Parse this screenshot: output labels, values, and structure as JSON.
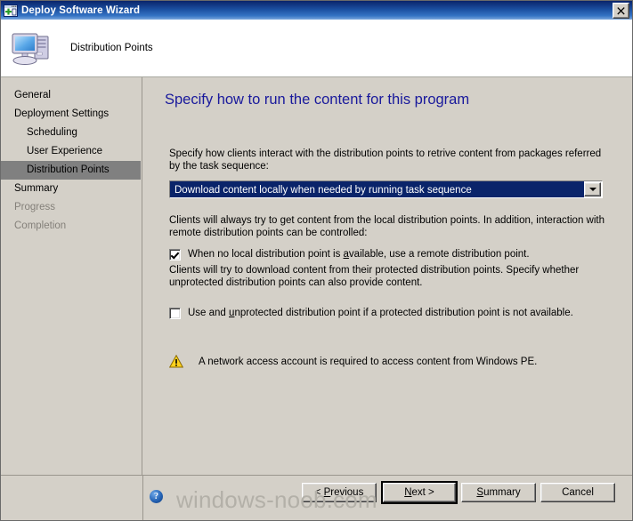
{
  "window": {
    "title": "Deploy Software Wizard",
    "title_icon": "wizard-window-add-icon",
    "close_label": "✕"
  },
  "header": {
    "icon": "computer-icon",
    "title": "Distribution Points"
  },
  "sidebar": {
    "items": [
      {
        "label": "General",
        "indent": false,
        "state": "normal"
      },
      {
        "label": "Deployment Settings",
        "indent": false,
        "state": "normal"
      },
      {
        "label": "Scheduling",
        "indent": true,
        "state": "normal"
      },
      {
        "label": "User Experience",
        "indent": true,
        "state": "normal"
      },
      {
        "label": "Distribution Points",
        "indent": true,
        "state": "selected"
      },
      {
        "label": "Summary",
        "indent": false,
        "state": "normal"
      },
      {
        "label": "Progress",
        "indent": false,
        "state": "disabled"
      },
      {
        "label": "Completion",
        "indent": false,
        "state": "disabled"
      }
    ]
  },
  "content": {
    "heading": "Specify how to run the content for this program",
    "heading_color": "#19199C",
    "paragraph_1": "Specify how clients interact with the distribution points to retrive content from packages referred by the task sequence:",
    "dropdown": {
      "name": "content-run-mode-select",
      "value": "Download content locally when needed by running task sequence",
      "options": [
        "Download content locally when needed by running task sequence"
      ],
      "selection_bg": "#0A246A",
      "selection_fg": "#FFFFFF"
    },
    "paragraph_2": "Clients will always try to get content from the local distribution points. In addition, interaction with remote distribution points can be controlled:",
    "checkbox_1": {
      "checked": true,
      "text_before": "When no local distribution point is ",
      "accel": "a",
      "text_after": "vailable, use a remote distribution point."
    },
    "paragraph_3": "Clients will try to download content from their protected distribution points. Specify whether unprotected distribution points can also provide content.",
    "checkbox_2": {
      "checked": false,
      "text_before": "Use and ",
      "accel": "u",
      "text_after": "nprotected distribution point if a protected distribution point is not available."
    },
    "warning": {
      "icon": "warning-triangle-icon",
      "text": "A network access account is required to access content from Windows PE."
    }
  },
  "footer": {
    "help_icon": "help-question-icon",
    "help_glyph": "?",
    "watermark": "windows-noob.com",
    "buttons": [
      {
        "name": "previous-button",
        "before": "< ",
        "accel": "P",
        "after": "revious",
        "default": false
      },
      {
        "name": "next-button",
        "before": "",
        "accel": "N",
        "after": "ext >",
        "default": true
      },
      {
        "name": "summary-button",
        "before": "",
        "accel": "S",
        "after": "ummary",
        "default": false
      },
      {
        "name": "cancel-button",
        "before": "Cancel",
        "accel": "",
        "after": "",
        "default": false
      }
    ]
  }
}
